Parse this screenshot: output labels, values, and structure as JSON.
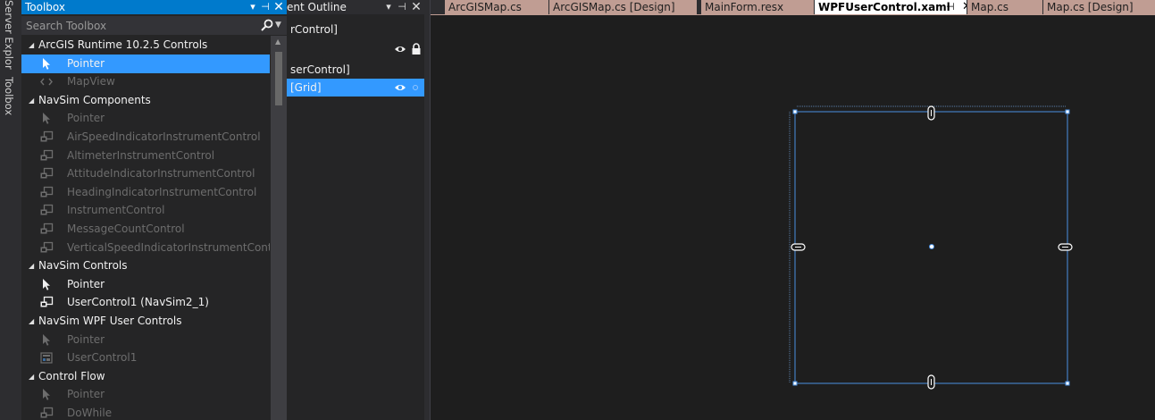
{
  "side_tabs": {
    "server_explorer": "Server Explorer",
    "toolbox": "Toolbox"
  },
  "toolbox": {
    "title": "Toolbox",
    "search_placeholder": "Search Toolbox",
    "items": [
      {
        "type": "category",
        "label": "ArcGIS Runtime 10.2.5 Controls"
      },
      {
        "type": "item",
        "label": "Pointer",
        "icon": "pointer-icon",
        "enabled": true,
        "selected": true
      },
      {
        "type": "item",
        "label": "MapView",
        "icon": "code-icon",
        "enabled": false
      },
      {
        "type": "category",
        "label": "NavSim Components"
      },
      {
        "type": "item",
        "label": "Pointer",
        "icon": "pointer-icon",
        "enabled": false
      },
      {
        "type": "item",
        "label": "AirSpeedIndicatorInstrumentControl",
        "icon": "component-icon",
        "enabled": false
      },
      {
        "type": "item",
        "label": "AltimeterInstrumentControl",
        "icon": "component-icon",
        "enabled": false
      },
      {
        "type": "item",
        "label": "AttitudeIndicatorInstrumentControl",
        "icon": "component-icon",
        "enabled": false
      },
      {
        "type": "item",
        "label": "HeadingIndicatorInstrumentControl",
        "icon": "component-icon",
        "enabled": false
      },
      {
        "type": "item",
        "label": "InstrumentControl",
        "icon": "component-icon",
        "enabled": false
      },
      {
        "type": "item",
        "label": "MessageCountControl",
        "icon": "component-icon",
        "enabled": false
      },
      {
        "type": "item",
        "label": "VerticalSpeedIndicatorInstrumentControl",
        "icon": "component-icon",
        "enabled": false
      },
      {
        "type": "category",
        "label": "NavSim Controls"
      },
      {
        "type": "item",
        "label": "Pointer",
        "icon": "pointer-icon",
        "enabled": true
      },
      {
        "type": "item",
        "label": "UserControl1 (NavSim2_1)",
        "icon": "component-icon",
        "enabled": true
      },
      {
        "type": "category",
        "label": "NavSim WPF User Controls"
      },
      {
        "type": "item",
        "label": "Pointer",
        "icon": "pointer-icon",
        "enabled": false
      },
      {
        "type": "item",
        "label": "UserControl1",
        "icon": "wpf-control-icon",
        "enabled": false
      },
      {
        "type": "category",
        "label": "Control Flow"
      },
      {
        "type": "item",
        "label": "Pointer",
        "icon": "pointer-icon",
        "enabled": false
      },
      {
        "type": "item",
        "label": "DoWhile",
        "icon": "component-icon",
        "enabled": false
      }
    ]
  },
  "outline": {
    "title": "ent Outline",
    "rows": [
      {
        "label": "rControl]"
      },
      {
        "label": ""
      },
      {
        "label": "serControl]"
      },
      {
        "label": "[Grid]"
      }
    ]
  },
  "doc_tabs": [
    {
      "label": "ArcGISMap.cs",
      "active": false
    },
    {
      "label": "ArcGISMap.cs [Design]",
      "active": false
    },
    {
      "label": "MainForm.resx",
      "active": false
    },
    {
      "label": "WPFUserControl.xaml",
      "active": true
    },
    {
      "label": "Map.cs",
      "active": false
    },
    {
      "label": "Map.cs [Design]",
      "active": false
    }
  ],
  "colors": {
    "accent": "#007acc",
    "selection": "#3399ff",
    "tab_inactive": "#c09d93",
    "designer_bg": "#1e1e1e",
    "adorner": "#4a90e2"
  }
}
